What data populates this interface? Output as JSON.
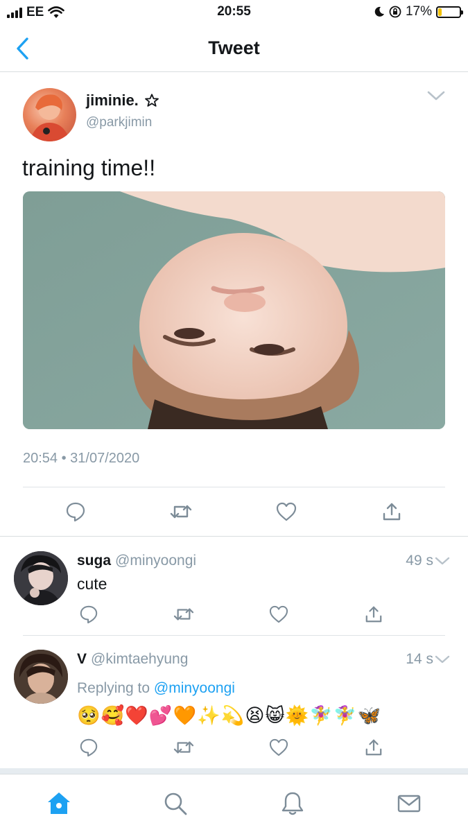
{
  "status_bar": {
    "carrier": "EE",
    "time": "20:55",
    "battery": "17%",
    "battery_level": 0.17,
    "icons": [
      "signal-icon",
      "wifi-icon",
      "moon-icon",
      "rotation-lock-icon",
      "battery-icon"
    ]
  },
  "header": {
    "title": "Tweet",
    "back_icon": "chevron-left-icon"
  },
  "main_tweet": {
    "name": "jiminie.",
    "name_icon": "star-outline-icon",
    "handle": "@parkjimin",
    "text": "training time!!",
    "timestamp": "20:54 • 31/07/2020",
    "actions": [
      "reply-icon",
      "retweet-icon",
      "like-icon",
      "share-icon"
    ]
  },
  "replies": [
    {
      "name": "suga",
      "handle": "@minyoongi",
      "time": "49 s",
      "text": "cute"
    },
    {
      "name": "V",
      "handle": "@kimtaehyung",
      "time": "14 s",
      "replying_prefix": "Replying to",
      "replying_to": "@minyoongi",
      "text": "🥺🥰❤️💕🧡✨💫😫😸🌞🧚‍♀️🧚‍♀️🦋"
    }
  ],
  "tabbar": {
    "items": [
      "home-icon",
      "search-icon",
      "notifications-icon",
      "messages-icon"
    ],
    "active": "home-icon"
  },
  "colors": {
    "accent": "#1da1f2",
    "secondary_text": "#8899a6",
    "divider": "#d9dde0"
  }
}
